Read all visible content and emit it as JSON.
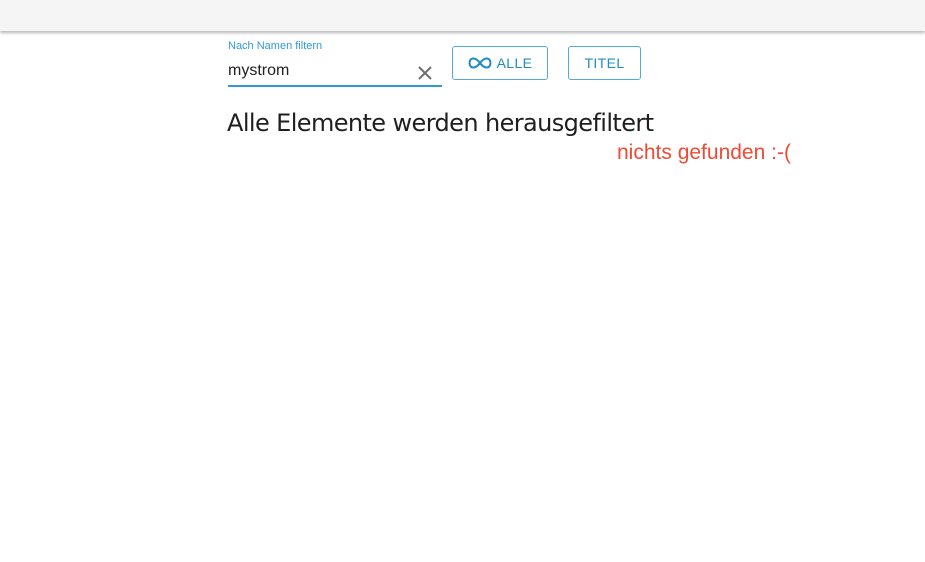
{
  "filter": {
    "label": "Nach Namen filtern",
    "value": "mystrom",
    "clear_icon": "close-icon",
    "accent_color": "#2e9bd6"
  },
  "buttons": {
    "all_label": "ALLE",
    "all_icon": "infinity-icon",
    "title_label": "TITEL"
  },
  "main": {
    "heading": "Alle Elemente werden herausgefiltert",
    "empty_message": "nichts gefunden :-(",
    "empty_color": "#f04a35"
  }
}
